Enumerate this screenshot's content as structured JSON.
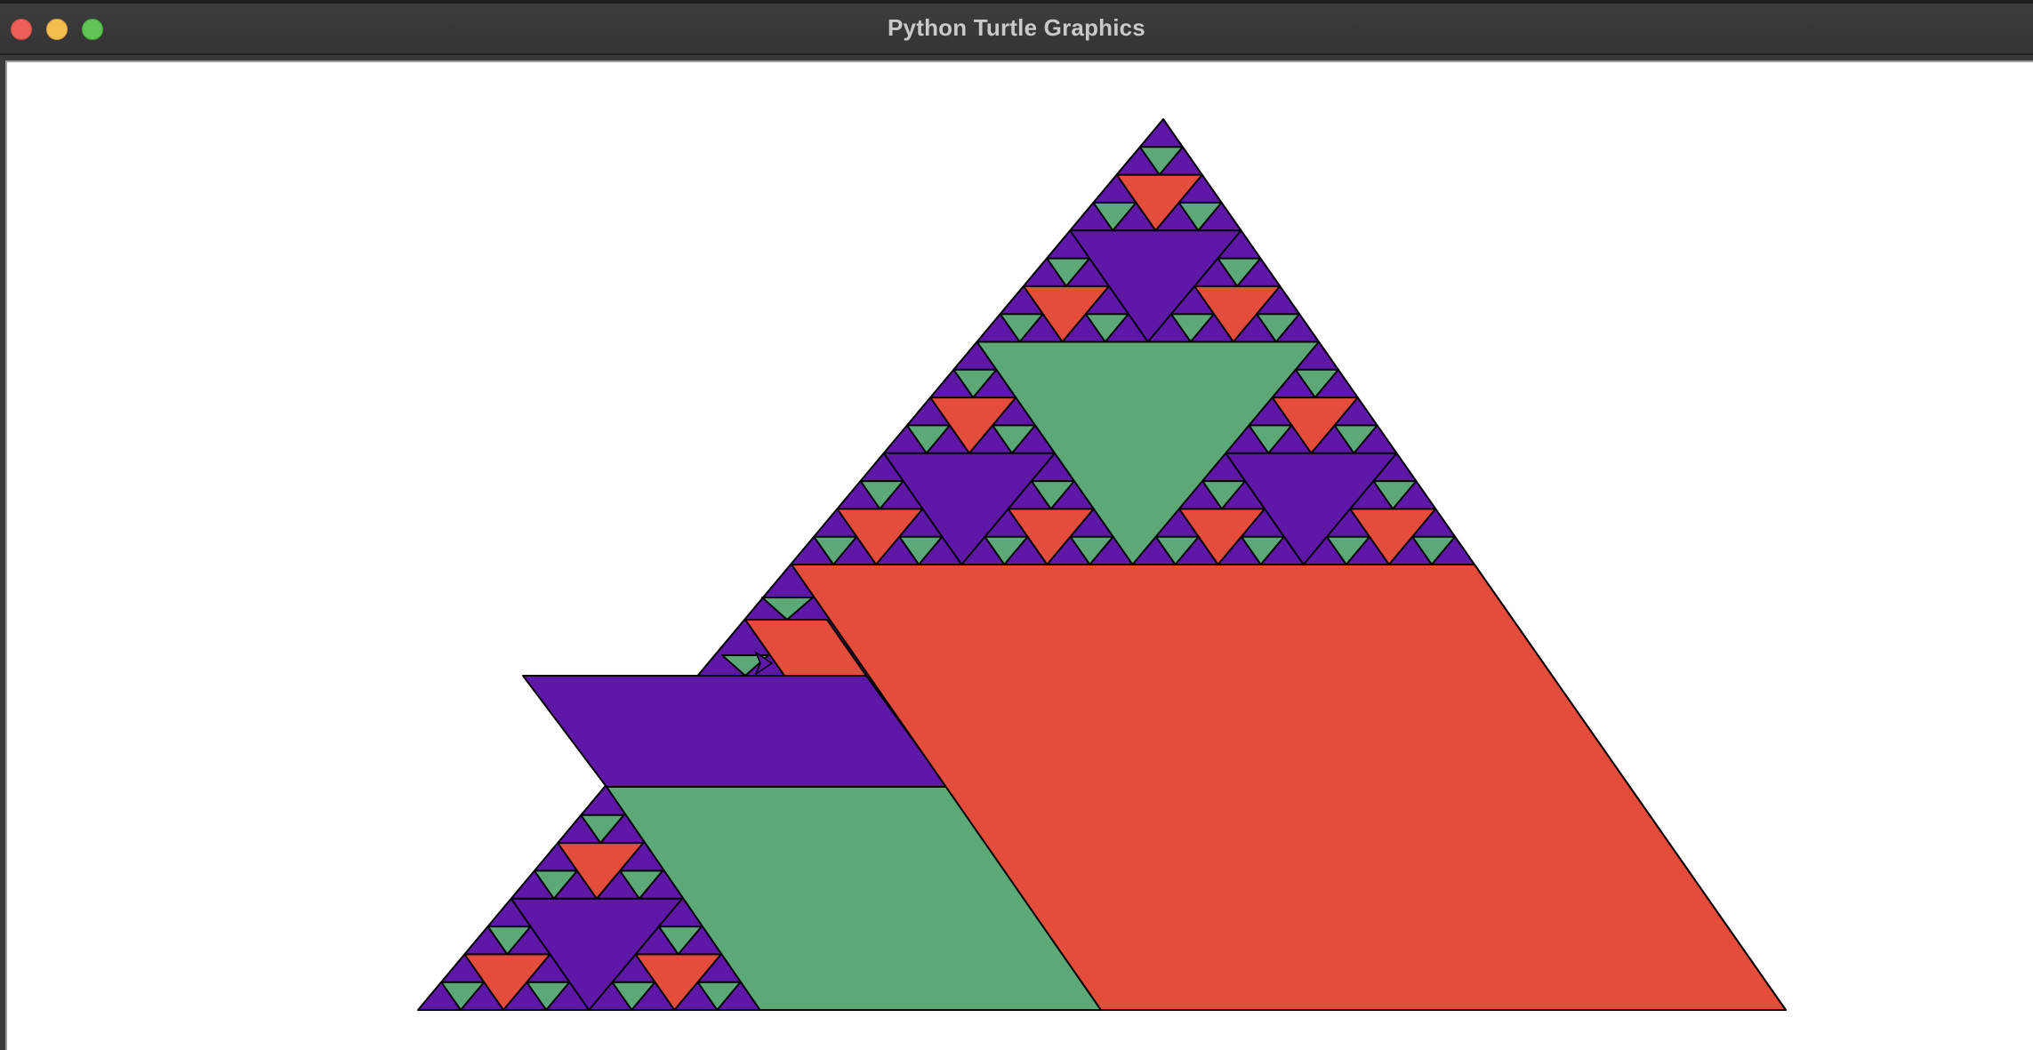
{
  "window": {
    "title": "Python Turtle Graphics"
  },
  "colors": {
    "purple": "#5f17a8",
    "red": "#e44c3c",
    "green": "#5ca977",
    "stroke": "#000000",
    "background": "#ffffff",
    "close": "#ec5f57",
    "minimize": "#f4bd4f",
    "zoom": "#5fc454"
  },
  "icons": {
    "turtle_cursor": "arrow-cursor-icon"
  }
}
